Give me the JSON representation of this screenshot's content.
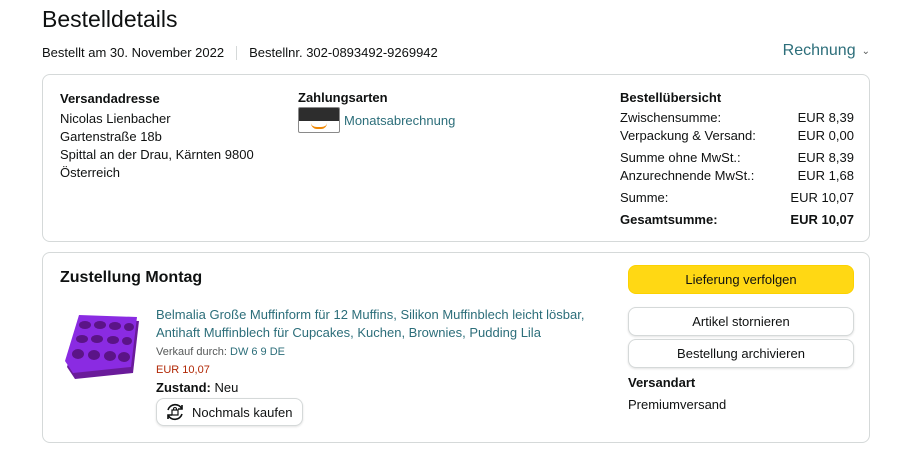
{
  "header": {
    "title": "Bestelldetails",
    "order_date": "Bestellt am 30. November 2022",
    "order_number": "Bestellnr. 302-0893492-9269942",
    "invoice_label": "Rechnung"
  },
  "shipping_address": {
    "title": "Versandadresse",
    "lines": [
      "Nicolas Lienbacher",
      "Gartenstraße 18b",
      "Spittal an der Drau, Kärnten 9800",
      "Österreich"
    ]
  },
  "payment": {
    "title": "Zahlungsarten",
    "method": "Monatsabrechnung"
  },
  "order_summary": {
    "title": "Bestellübersicht",
    "rows": [
      {
        "label": "Zwischensumme:",
        "value": "EUR 8,39"
      },
      {
        "label": "Verpackung & Versand:",
        "value": "EUR 0,00"
      },
      {
        "label": "Summe ohne MwSt.:",
        "value": "EUR 8,39"
      },
      {
        "label": "Anzurechnende MwSt.:",
        "value": "EUR 1,68"
      },
      {
        "label": "Summe:",
        "value": "EUR 10,07"
      },
      {
        "label": "Gesamtsumme:",
        "value": "EUR 10,07"
      }
    ]
  },
  "delivery": {
    "title": "Zustellung Montag",
    "product": {
      "title": "Belmalia Große Muffinform für 12 Muffins, Silikon Muffinblech leicht lösbar, Antihaft Muffinblech für Cupcakes, Kuchen, Brownies, Pudding Lila",
      "seller_prefix": "Verkauf durch:",
      "seller_name": "DW 6 9 DE",
      "price": "EUR 10,07",
      "condition_label": "Zustand:",
      "condition_value": "Neu",
      "buy_again_label": "Nochmals kaufen",
      "image_color": "#8a2be2"
    },
    "buttons": {
      "track": "Lieferung verfolgen",
      "cancel": "Artikel stornieren",
      "archive": "Bestellung archivieren"
    },
    "shipping_type_title": "Versandart",
    "shipping_type_value": "Premiumversand"
  },
  "colors": {
    "link": "#2c6e7a",
    "primary_button": "#ffd814",
    "price": "#b12704"
  }
}
